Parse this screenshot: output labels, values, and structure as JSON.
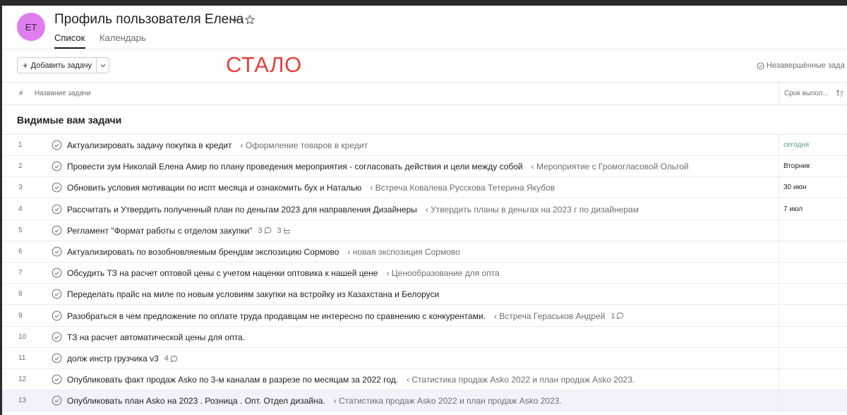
{
  "header": {
    "avatar_initials": "ET",
    "title": "Профиль пользователя Елена",
    "tabs": [
      {
        "label": "Список",
        "active": true
      },
      {
        "label": "Календарь",
        "active": false
      }
    ]
  },
  "toolbar": {
    "add_task_label": "Добавить задачу",
    "annotation": "СТАЛО",
    "filter_label": "Незавершённые зада"
  },
  "table": {
    "columns": {
      "number": "#",
      "task_name": "Название задачи",
      "due": "Срок выпол..."
    },
    "section_title": "Видимые вам задачи",
    "rows": [
      {
        "num": "1",
        "name": "Актуализировать задачу покупка в кредит",
        "project": "‹ Оформление товаров в кредит",
        "meta": "",
        "due": "сегодня"
      },
      {
        "num": "2",
        "name": "Провести зум Николай Елена Амир по плану проведения мероприятия - согласовать действия и цели между собой",
        "project": "‹ Мероприятие с Громогласовой Ольгой",
        "meta": "",
        "due": "Вторник"
      },
      {
        "num": "3",
        "name": "Обновить условия мотивации по испт месяца и ознакомить бух и Наталью",
        "project": "‹ Встреча Ковалева Русскова Тетерина Якубов",
        "meta": "",
        "due": "30 июн"
      },
      {
        "num": "4",
        "name": "Рассчитать и Утвердить полученный план по деньгам 2023 для направления Дизайнеры",
        "project": "‹ Утвердить планы в деньгах на 2023 г по дизайнерам",
        "meta": "",
        "due": "7 июл"
      },
      {
        "num": "5",
        "name": "Регламент \"Формат работы с отделом закупки\"",
        "project": "",
        "meta": "3",
        "meta2": "3",
        "due": ""
      },
      {
        "num": "6",
        "name": "Актуализировать по возобновляемым брендам экспозицию Сормово",
        "project": "‹ новая экспозиция Сормово",
        "meta": "",
        "due": ""
      },
      {
        "num": "7",
        "name": "Обсудить ТЗ на расчет оптовой цены с учетом наценки оптовика к нашей цене",
        "project": "‹ Ценообразование для опта",
        "meta": "",
        "due": ""
      },
      {
        "num": "8",
        "name": "Переделать прайс на миле по новым условиям закупки на встройку из Казахстана и Белоруси",
        "project": "",
        "meta": "",
        "due": ""
      },
      {
        "num": "9",
        "name": "Разобраться в чем предложение по оплате труда продавцам не интересно по сравнению с конкурентами.",
        "project": "‹ Встреча Гераськов Андрей",
        "meta": "1",
        "due": ""
      },
      {
        "num": "10",
        "name": "ТЗ на расчет автоматической цены для опта.",
        "project": "",
        "meta": "",
        "due": ""
      },
      {
        "num": "11",
        "name": "долж инстр грузчика v3",
        "project": "",
        "meta": "4",
        "due": ""
      },
      {
        "num": "12",
        "name": "Опубликовать факт продаж Asko по 3-м каналам в разрезе по месяцам за 2022 год.",
        "project": "‹ Статистика продаж Asko 2022 и план продаж Asko 2023.",
        "meta": "",
        "due": ""
      },
      {
        "num": "13",
        "name": "Опубликовать план Asko на 2023 . Розница . Опт. Отдел дизайна.",
        "project": "‹ Статистика продаж Asko 2022 и план продаж Asko 2023.",
        "meta": "",
        "due": ""
      }
    ]
  }
}
